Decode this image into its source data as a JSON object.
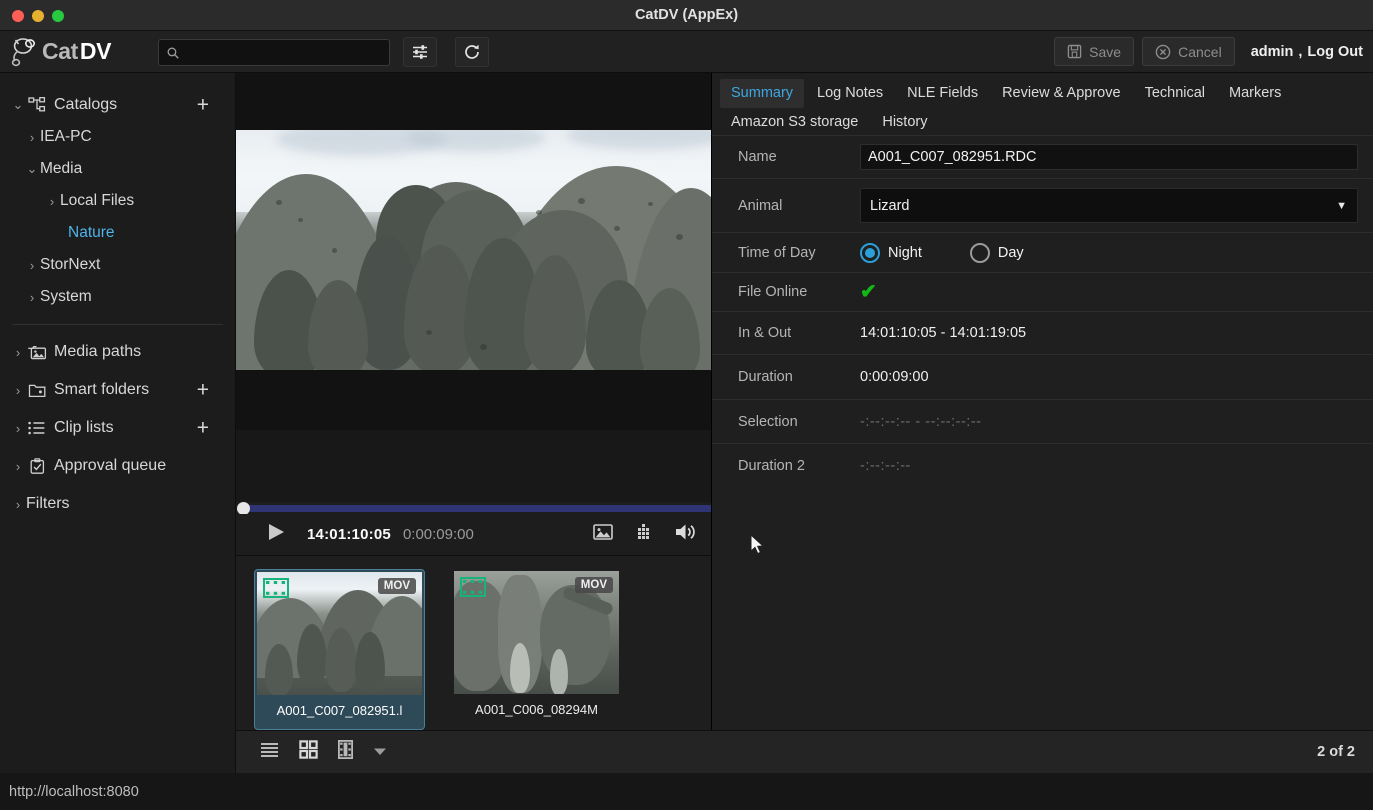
{
  "window": {
    "title": "CatDV (AppEx)",
    "traffic_lights": [
      "close",
      "minimize",
      "zoom"
    ]
  },
  "header": {
    "logo_cat": "Cat",
    "logo_dv": "DV",
    "search_value": "",
    "search_placeholder": "",
    "filters_icon": "sliders-icon",
    "refresh_icon": "refresh-icon",
    "save_label": "Save",
    "cancel_label": "Cancel",
    "user_name": "admin",
    "user_separator": ",",
    "logout_label": "Log Out"
  },
  "sidebar": {
    "items": [
      {
        "label": "Catalogs",
        "level": 0,
        "chevron": "down",
        "icon": "catalogs-icon",
        "plus": true,
        "selected": false
      },
      {
        "label": "IEA-PC",
        "level": 1,
        "chevron": "right",
        "icon": "",
        "plus": false,
        "selected": false
      },
      {
        "label": "Media",
        "level": 1,
        "chevron": "down",
        "icon": "",
        "plus": false,
        "selected": false
      },
      {
        "label": "Local Files",
        "level": 2,
        "chevron": "right",
        "icon": "",
        "plus": false,
        "selected": false
      },
      {
        "label": "Nature",
        "level": 3,
        "chevron": "",
        "icon": "",
        "plus": false,
        "selected": true
      },
      {
        "label": "StorNext",
        "level": 1,
        "chevron": "right",
        "icon": "",
        "plus": false,
        "selected": false
      },
      {
        "label": "System",
        "level": 1,
        "chevron": "right",
        "icon": "",
        "plus": false,
        "selected": false
      }
    ],
    "items2": [
      {
        "label": "Media paths",
        "level": 0,
        "chevron": "right",
        "icon": "media-paths-icon",
        "plus": false,
        "selected": false
      },
      {
        "label": "Smart folders",
        "level": 0,
        "chevron": "right",
        "icon": "smart-folder-icon",
        "plus": true,
        "selected": false
      },
      {
        "label": "Clip lists",
        "level": 0,
        "chevron": "right",
        "icon": "list-icon",
        "plus": true,
        "selected": false
      },
      {
        "label": "Approval queue",
        "level": 0,
        "chevron": "right",
        "icon": "checklist-icon",
        "plus": false,
        "selected": false
      },
      {
        "label": "Filters",
        "level": 0,
        "chevron": "right",
        "icon": "",
        "plus": false,
        "selected": false
      }
    ]
  },
  "player": {
    "play_icon": "play-icon",
    "timecode": "14:01:10:05",
    "duration": "0:00:09:00",
    "poster_icon": "image-icon",
    "storyboard_icon": "grid-dots-icon",
    "volume_icon": "volume-icon",
    "scrub_position_pct": 0
  },
  "browser": {
    "thumbnails": [
      {
        "caption": "A001_C007_082951.l",
        "badge": "MOV",
        "selected": true
      },
      {
        "caption": "A001_C006_08294M",
        "badge": "MOV",
        "selected": false
      }
    ],
    "view_icons": [
      "list-view-icon",
      "grid-view-icon",
      "filmstrip-view-icon",
      "chevron-down-icon"
    ],
    "count_label": "2 of 2"
  },
  "metadata": {
    "tabs_row1": [
      {
        "label": "Summary",
        "active": true
      },
      {
        "label": "Log Notes",
        "active": false
      },
      {
        "label": "NLE Fields",
        "active": false
      },
      {
        "label": "Review & Approve",
        "active": false
      },
      {
        "label": "Technical",
        "active": false
      },
      {
        "label": "Markers",
        "active": false
      }
    ],
    "tabs_row2": [
      {
        "label": "Amazon S3 storage",
        "active": false
      },
      {
        "label": "History",
        "active": false
      }
    ],
    "fields": {
      "name_label": "Name",
      "name_value": "A001_C007_082951.RDC",
      "animal_label": "Animal",
      "animal_value": "Lizard",
      "animal_caret": "▼",
      "time_of_day_label": "Time of Day",
      "time_of_day_options": [
        {
          "label": "Night",
          "selected": true
        },
        {
          "label": "Day",
          "selected": false
        }
      ],
      "file_online_label": "File Online",
      "file_online_value": "✔",
      "in_out_label": "In & Out",
      "in_out_value": "14:01:10:05 - 14:01:19:05",
      "duration_label": "Duration",
      "duration_value": "0:00:09:00",
      "selection_label": "Selection",
      "selection_value": "-:--:--:-- - --:--:--:--",
      "duration2_label": "Duration 2",
      "duration2_value": "-:--:--:--"
    }
  },
  "statusbar": {
    "url": "http://localhost:8080"
  },
  "colors": {
    "accent_blue": "#3ca8e0",
    "selected_blue": "#4eb3e8",
    "online_green": "#14b814",
    "scrub_blue": "#2f3474",
    "thumb_select": "#2e4a58",
    "film_badge_green": "#16b47a"
  }
}
